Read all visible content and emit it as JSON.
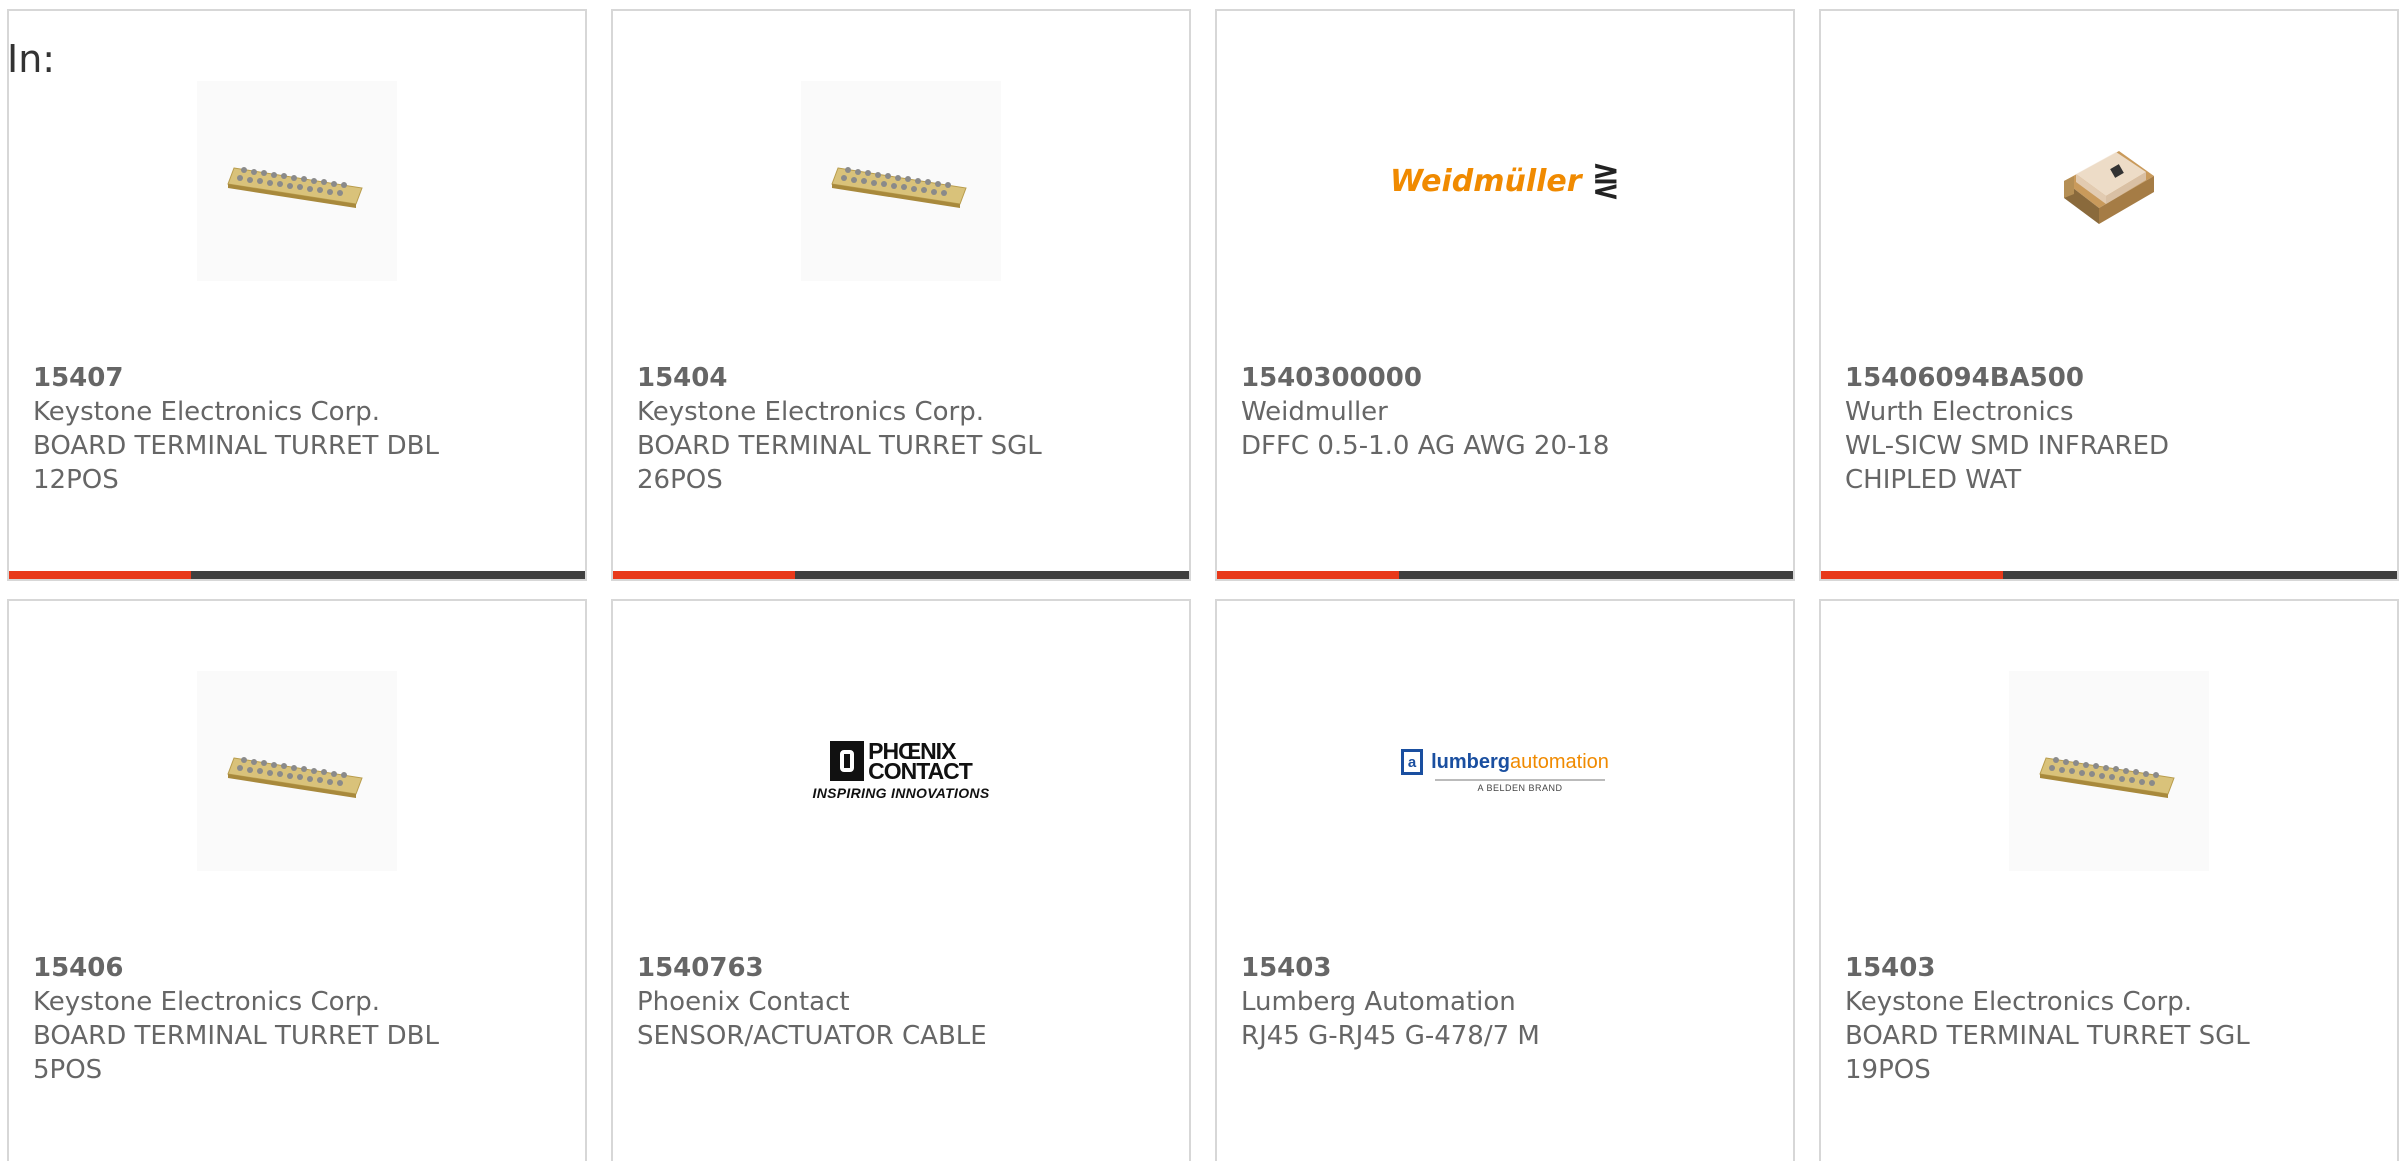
{
  "header": {
    "label": "In:"
  },
  "colors": {
    "accent": "#e8391a",
    "bar": "#3f3f3f",
    "border": "#d7d7d7",
    "text": "#666666"
  },
  "cards": [
    {
      "part_number": "15407",
      "manufacturer": "Keystone Electronics Corp.",
      "desc1": "BOARD TERMINAL TURRET DBL",
      "desc2": "12POS",
      "image": "turret-board-photo"
    },
    {
      "part_number": "15404",
      "manufacturer": "Keystone Electronics Corp.",
      "desc1": "BOARD TERMINAL TURRET SGL",
      "desc2": "26POS",
      "image": "turret-board-photo"
    },
    {
      "part_number": "1540300000",
      "manufacturer": "Weidmuller",
      "desc1": "DFFC 0.5-1.0 AG AWG 20-18",
      "desc2": "",
      "image": "weidmuller-logo",
      "logo_text": "Weidmüller",
      "logo_mark": "⋛"
    },
    {
      "part_number": "15406094BA500",
      "manufacturer": "Wurth Electronics",
      "desc1": "WL-SICW SMD INFRARED",
      "desc2": "CHIPLED WAT",
      "image": "smd-led-photo"
    },
    {
      "part_number": "15406",
      "manufacturer": "Keystone Electronics Corp.",
      "desc1": "BOARD TERMINAL TURRET DBL",
      "desc2": "5POS",
      "image": "turret-board-photo"
    },
    {
      "part_number": "1540763",
      "manufacturer": "Phoenix Contact",
      "desc1": "SENSOR/ACTUATOR CABLE",
      "desc2": "",
      "image": "phoenix-contact-logo",
      "logo_line1": "PHŒNIX",
      "logo_line2": "CONTACT",
      "logo_tag": "INSPIRING INNOVATIONS"
    },
    {
      "part_number": "15403",
      "manufacturer": "Lumberg Automation",
      "desc1": "RJ45 G-RJ45 G-478/7 M",
      "desc2": "",
      "image": "lumberg-automation-logo",
      "logo_box": "a",
      "logo_w1": "lumberg",
      "logo_w2": "automation",
      "logo_sub": "A BELDEN BRAND"
    },
    {
      "part_number": "15403",
      "manufacturer": "Keystone Electronics Corp.",
      "desc1": "BOARD TERMINAL TURRET SGL",
      "desc2": "19POS",
      "image": "turret-board-photo"
    }
  ]
}
